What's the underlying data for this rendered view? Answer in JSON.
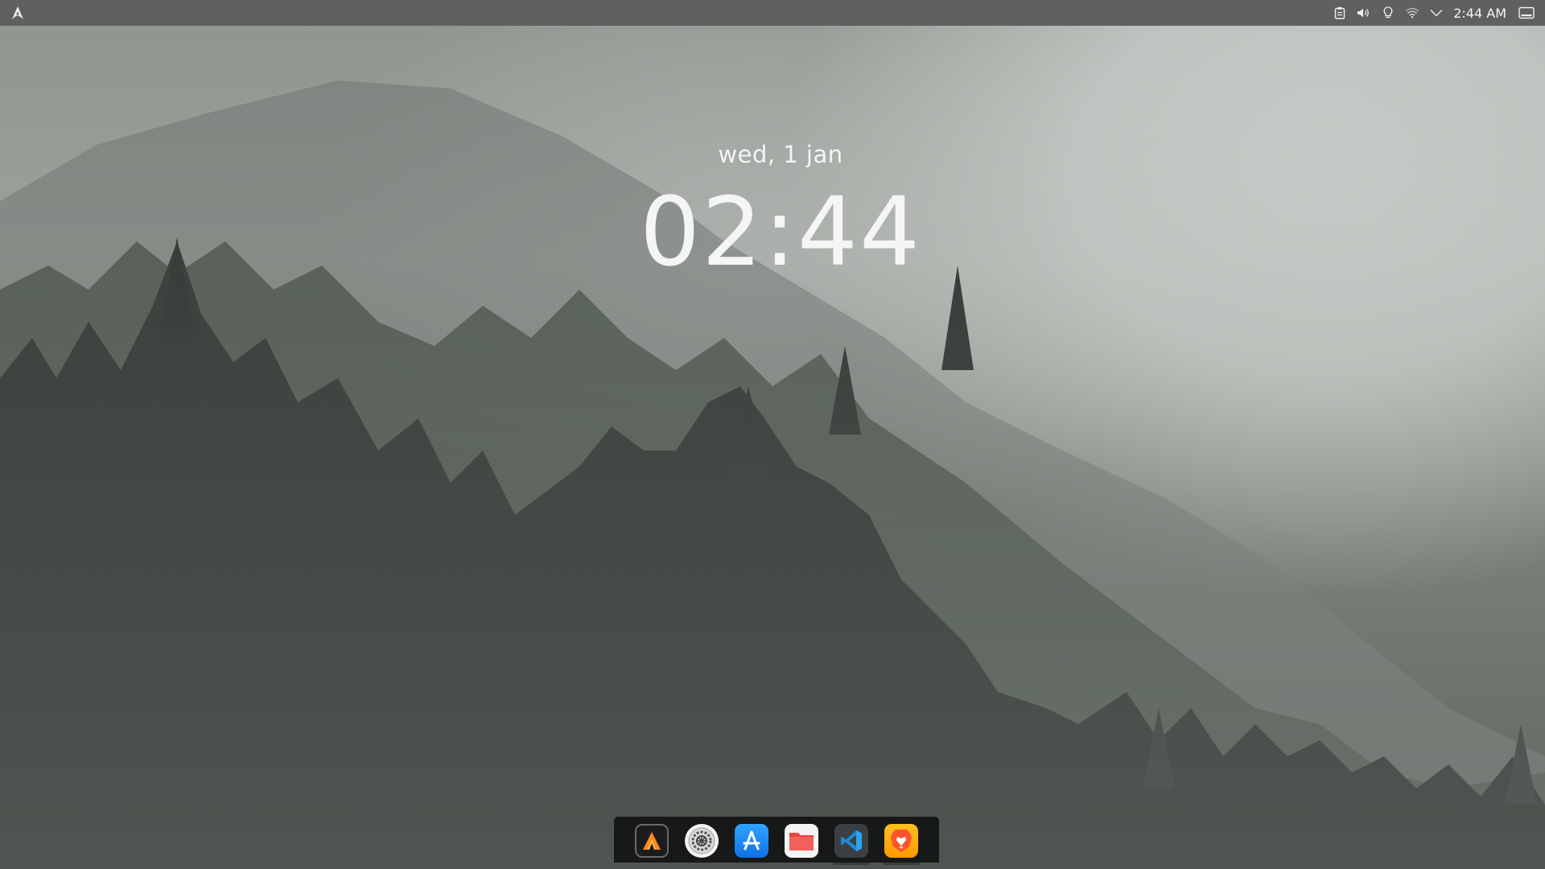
{
  "top_panel": {
    "launcher_icon": "arch-logo-icon",
    "tray_icons": [
      "clipboard-icon",
      "volume-icon",
      "lightbulb-icon",
      "wifi-icon",
      "chevron-down-icon"
    ],
    "clock": "2:44 AM",
    "show_desktop_icon": "show-desktop-icon"
  },
  "clock_widget": {
    "date": "wed, 1 jan",
    "time": "02:44"
  },
  "dock": {
    "items": [
      {
        "name": "app-launcher",
        "icon": "arch-a-icon",
        "active": false
      },
      {
        "name": "system-settings",
        "icon": "gear-icon",
        "active": false
      },
      {
        "name": "app-store",
        "icon": "app-store-icon",
        "active": false
      },
      {
        "name": "files",
        "icon": "folder-icon",
        "active": false
      },
      {
        "name": "vscode",
        "icon": "vscode-icon",
        "active": true
      },
      {
        "name": "brave-browser",
        "icon": "brave-lion-icon",
        "active": true
      }
    ]
  },
  "colors": {
    "panel_bg": "#5f605f",
    "dock_bg": "#121414",
    "text": "#f5f5f5"
  }
}
